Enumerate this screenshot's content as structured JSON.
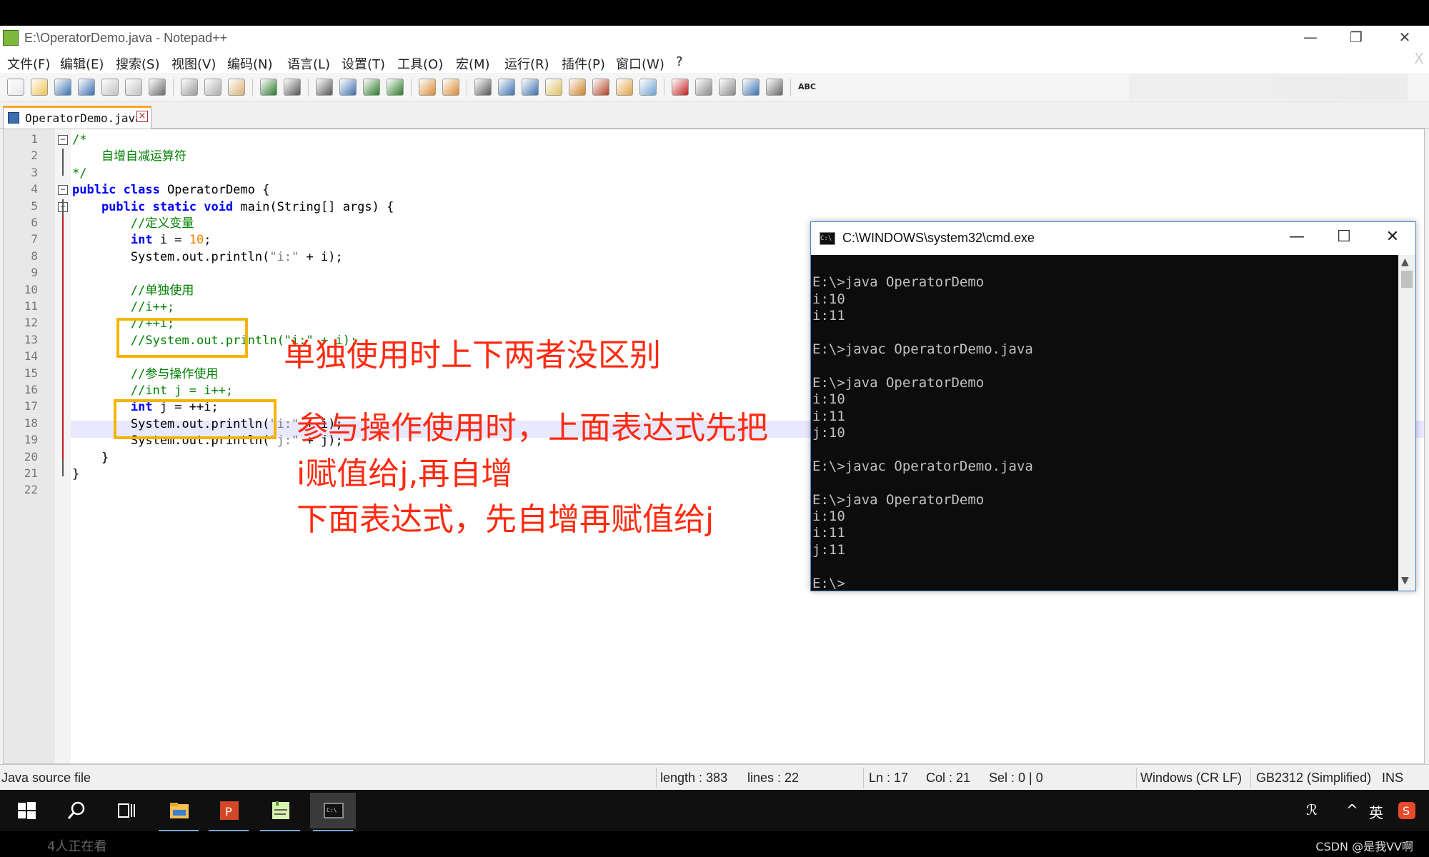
{
  "window": {
    "title": "E:\\OperatorDemo.java - Notepad++",
    "minimize_glyph": "—",
    "restore_glyph": "❐",
    "close_glyph": "✕",
    "doc_close_glyph": "X"
  },
  "menu": [
    "文件(F)",
    "编辑(E)",
    "搜索(S)",
    "视图(V)",
    "编码(N)",
    "语言(L)",
    "设置(T)",
    "工具(O)",
    "宏(M)",
    "运行(R)",
    "插件(P)",
    "窗口(W)",
    "?"
  ],
  "toolbar": {
    "icons": [
      "new-file-icon",
      "open-file-icon",
      "save-icon",
      "save-all-icon",
      "close-icon",
      "close-all-icon",
      "print-icon",
      "cut-icon",
      "copy-icon",
      "paste-icon",
      "undo-icon",
      "redo-icon",
      "find-icon",
      "replace-icon",
      "zoom-in-icon",
      "zoom-out-icon",
      "sync-vertical-icon",
      "sync-horizontal-icon",
      "word-wrap-icon",
      "show-all-chars-icon",
      "indent-guide-icon",
      "language-icon",
      "doc-map-icon",
      "function-list-icon",
      "folder-workspace-icon",
      "monitor-icon",
      "record-macro-icon",
      "stop-macro-icon",
      "play-macro-icon",
      "run-macro-multiple-icon",
      "save-macro-icon",
      "spell-check-icon"
    ],
    "spellcheck_label": "ABC"
  },
  "tab": {
    "label": "OperatorDemo.java"
  },
  "editor": {
    "line_numbers": [
      "1",
      "2",
      "3",
      "4",
      "5",
      "6",
      "7",
      "8",
      "9",
      "10",
      "11",
      "12",
      "13",
      "14",
      "15",
      "16",
      "17",
      "18",
      "19",
      "20",
      "21",
      "22"
    ],
    "lines": [
      {
        "segments": [
          {
            "t": "/*",
            "c": "cm"
          }
        ]
      },
      {
        "segments": [
          {
            "t": "    自增自减运算符",
            "c": "cm"
          }
        ]
      },
      {
        "segments": [
          {
            "t": "*/",
            "c": "cm"
          }
        ]
      },
      {
        "segments": [
          {
            "t": "public class ",
            "c": "kw"
          },
          {
            "t": "OperatorDemo {",
            "c": ""
          }
        ]
      },
      {
        "segments": [
          {
            "t": "    public static void ",
            "c": "kw"
          },
          {
            "t": "main(String[] args) {",
            "c": ""
          }
        ]
      },
      {
        "segments": [
          {
            "t": "        //定义变量",
            "c": "cm"
          }
        ]
      },
      {
        "segments": [
          {
            "t": "        int ",
            "c": "kw"
          },
          {
            "t": "i = ",
            "c": ""
          },
          {
            "t": "10",
            "c": "num"
          },
          {
            "t": ";",
            "c": ""
          }
        ]
      },
      {
        "segments": [
          {
            "t": "        System.out.println(",
            "c": ""
          },
          {
            "t": "\"i:\"",
            "c": "str"
          },
          {
            "t": " + i);",
            "c": ""
          }
        ]
      },
      {
        "segments": [
          {
            "t": "",
            "c": ""
          }
        ]
      },
      {
        "segments": [
          {
            "t": "        //单独使用",
            "c": "cm"
          }
        ]
      },
      {
        "segments": [
          {
            "t": "        //i++;",
            "c": "cm"
          }
        ]
      },
      {
        "segments": [
          {
            "t": "        //++i;",
            "c": "cm"
          }
        ]
      },
      {
        "segments": [
          {
            "t": "        //System.out.println(\"i:\" + i);",
            "c": "cm"
          }
        ]
      },
      {
        "segments": [
          {
            "t": "",
            "c": ""
          }
        ]
      },
      {
        "segments": [
          {
            "t": "        //参与操作使用",
            "c": "cm"
          }
        ]
      },
      {
        "segments": [
          {
            "t": "        //int j = i++;",
            "c": "cm"
          }
        ]
      },
      {
        "segments": [
          {
            "t": "        int ",
            "c": "kw"
          },
          {
            "t": "j = ++i;",
            "c": ""
          }
        ]
      },
      {
        "segments": [
          {
            "t": "        System.out.println(",
            "c": ""
          },
          {
            "t": "\"i:\"",
            "c": "str"
          },
          {
            "t": " + i);",
            "c": ""
          }
        ]
      },
      {
        "segments": [
          {
            "t": "        System.out.println(",
            "c": ""
          },
          {
            "t": "\"j:\"",
            "c": "str"
          },
          {
            "t": " + j);",
            "c": ""
          }
        ]
      },
      {
        "segments": [
          {
            "t": "    }",
            "c": ""
          }
        ]
      },
      {
        "segments": [
          {
            "t": "}",
            "c": ""
          }
        ]
      },
      {
        "segments": [
          {
            "t": "",
            "c": ""
          }
        ]
      }
    ]
  },
  "annotations": {
    "note1": "单独使用时上下两者没区别",
    "note2_line1": "参与操作使用时，上面表达式先把",
    "note2_line2": "i赋值给j,再自增",
    "note2_line3": "下面表达式，先自增再赋值给j",
    "box_color": "#f5b400",
    "text_color": "#ff2a10"
  },
  "status": {
    "file_type": "Java source file",
    "length": "length : 383",
    "lines": "lines : 22",
    "ln": "Ln : 17",
    "col": "Col : 21",
    "sel": "Sel : 0 | 0",
    "eol": "Windows (CR LF)",
    "encoding": "GB2312 (Simplified)",
    "mode": "INS"
  },
  "cmd": {
    "title": "C:\\WINDOWS\\system32\\cmd.exe",
    "icon_label": "C:\\",
    "minimize_glyph": "—",
    "maximize_glyph": "☐",
    "close_glyph": "✕",
    "output": [
      "",
      "E:\\>java OperatorDemo",
      "i:10",
      "i:11",
      "",
      "E:\\>javac OperatorDemo.java",
      "",
      "E:\\>java OperatorDemo",
      "i:10",
      "i:11",
      "j:10",
      "",
      "E:\\>javac OperatorDemo.java",
      "",
      "E:\\>java OperatorDemo",
      "i:10",
      "i:11",
      "j:11",
      "",
      "E:\\>"
    ]
  },
  "taskbar": {
    "ime": "英",
    "tray_people_glyph": "ℛ",
    "tray_chevron_glyph": "^"
  },
  "video": {
    "viewers": "4人正在看",
    "watermark": "CSDN @是我VV啊"
  }
}
